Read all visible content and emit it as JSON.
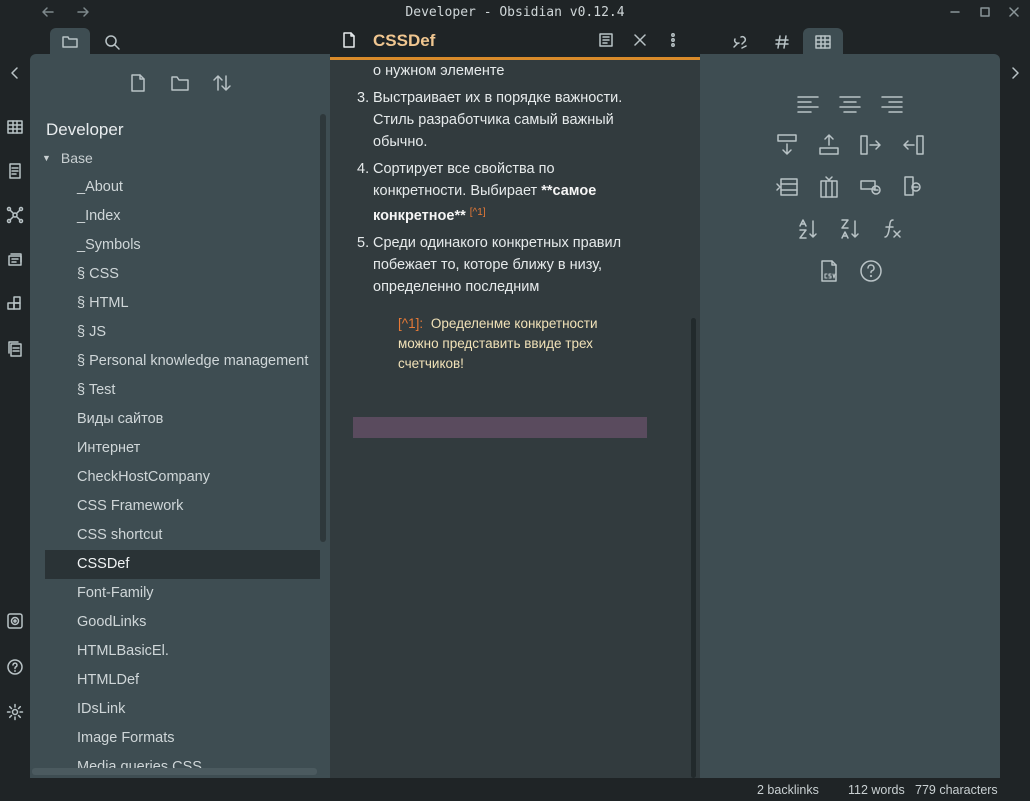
{
  "window": {
    "title": "Developer - Obsidian v0.12.4"
  },
  "explorer": {
    "vault_name": "Developer",
    "folder": "Base",
    "files": [
      "_About",
      "_Index",
      "_Symbols",
      "§ CSS",
      "§ HTML",
      "§ JS",
      "§ Personal knowledge management",
      "§ Test",
      "Виды сайтов",
      "Интернет",
      "CheckHostCompany",
      "CSS Framework",
      "CSS shortcut",
      "CSSDef",
      "Font-Family",
      "GoodLinks",
      "HTMLBasicEl.",
      "HTMLDef",
      "IDsLink",
      "Image Formats",
      "Media queries CSS"
    ],
    "active_file": "CSSDef"
  },
  "editor": {
    "title": "CSSDef",
    "fragment": "о нужном элементе",
    "items": [
      {
        "n": "3.",
        "text": "Выстраивает их в порядке важности. Стиль разработчика самый важный обычно."
      },
      {
        "n": "4.",
        "text_pre": "Сортирует все свойства по конкретности. Выбирает ",
        "bold": "**самое конкретное**",
        "ref": "[^1]"
      },
      {
        "n": "5.",
        "text": "Среди одинакого конкретных правил побежает то, которе ближу в низу, определенно последним"
      }
    ],
    "footnote_label": "[^1]:",
    "footnote_text": "Оределенме конкретности можно представить ввиде трех счетчиков!"
  },
  "status": {
    "backlinks": "2 backlinks",
    "words": "112 words",
    "characters": "779 characters"
  },
  "colors": {
    "accent": "#d88a2a",
    "title": "#f0c690",
    "footnote_ref": "#e77a37",
    "highlight": "#5a4b5e"
  }
}
